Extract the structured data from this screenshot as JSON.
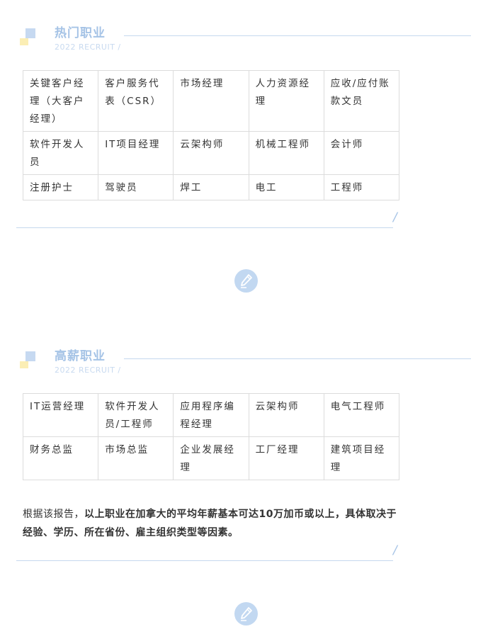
{
  "sections": [
    {
      "title": "热门职业",
      "subtitle": "2022 RECRUIT /",
      "rows": [
        [
          "关键客户经理（大客户经理）",
          "客户服务代表（CSR）",
          "市场经理",
          "人力资源经理",
          "应收/应付账款文员"
        ],
        [
          "软件开发人员",
          "IT项目经理",
          "云架构师",
          "机械工程师",
          "会计师"
        ],
        [
          "注册护士",
          "驾驶员",
          "焊工",
          "电工",
          "工程师"
        ]
      ],
      "end_mark": "/"
    },
    {
      "title": "高薪职业",
      "subtitle": "2022 RECRUIT /",
      "rows": [
        [
          "IT运营经理",
          "软件开发人员/工程师",
          "应用程序编程经理",
          "云架构师",
          "电气工程师"
        ],
        [
          "财务总监",
          "市场总监",
          "企业发展经理",
          "工厂经理",
          "建筑项目经理"
        ]
      ],
      "end_mark": "/"
    }
  ],
  "note": {
    "prefix": "根据该报告，",
    "bold": "以上职业在加拿大的平均年薪基本可达10万加币或以上，具体取决于经验、学历、所在省份、雇主组织类型等因素。"
  },
  "icons": {
    "divider": "pen-icon",
    "accent_color": "#a5c3e6"
  }
}
